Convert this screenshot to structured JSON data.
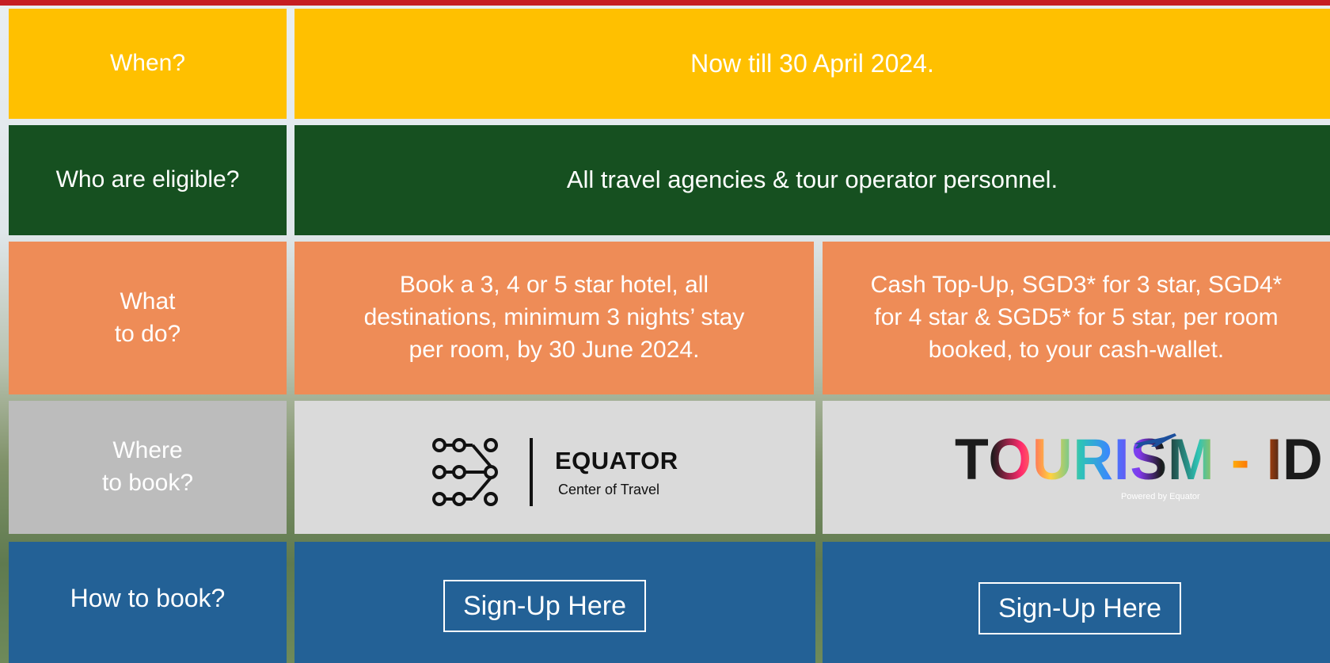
{
  "rows": {
    "when": {
      "label": "When?",
      "value": "Now till 30 April 2024."
    },
    "who": {
      "label": "Who are eligible?",
      "value": "All  travel agencies & tour operator personnel."
    },
    "what": {
      "label": "What\nto do?",
      "booking": "Book a 3, 4 or 5 star hotel, all\ndestinations, minimum  3 nights’ stay\nper room, by 30 June 2024.",
      "reward": "Cash Top-Up, SGD3* for 3 star, SGD4*\nfor 4 star & SGD5* for 5 star, per room\nbooked, to your cash-wallet."
    },
    "where": {
      "label": "Where\nto book?",
      "equator_logo": {
        "name": "EQUATOR",
        "tagline": "Center of Travel",
        "icon": "network-nodes-icon"
      },
      "tourism_logo": {
        "name": "TOURISM - ID",
        "tagline": "Powered by Equator",
        "icon": "airplane-icon"
      }
    },
    "how": {
      "label": "How to book?",
      "button_left": "Sign-Up Here",
      "button_right": "Sign-Up Here"
    }
  },
  "colors": {
    "yellow": "#ffc000",
    "green": "#165020",
    "orange": "#ee8c57",
    "grey": "#bcbcbc",
    "light_grey": "#dadada",
    "blue": "#236196",
    "top_line": "#c61d23"
  }
}
